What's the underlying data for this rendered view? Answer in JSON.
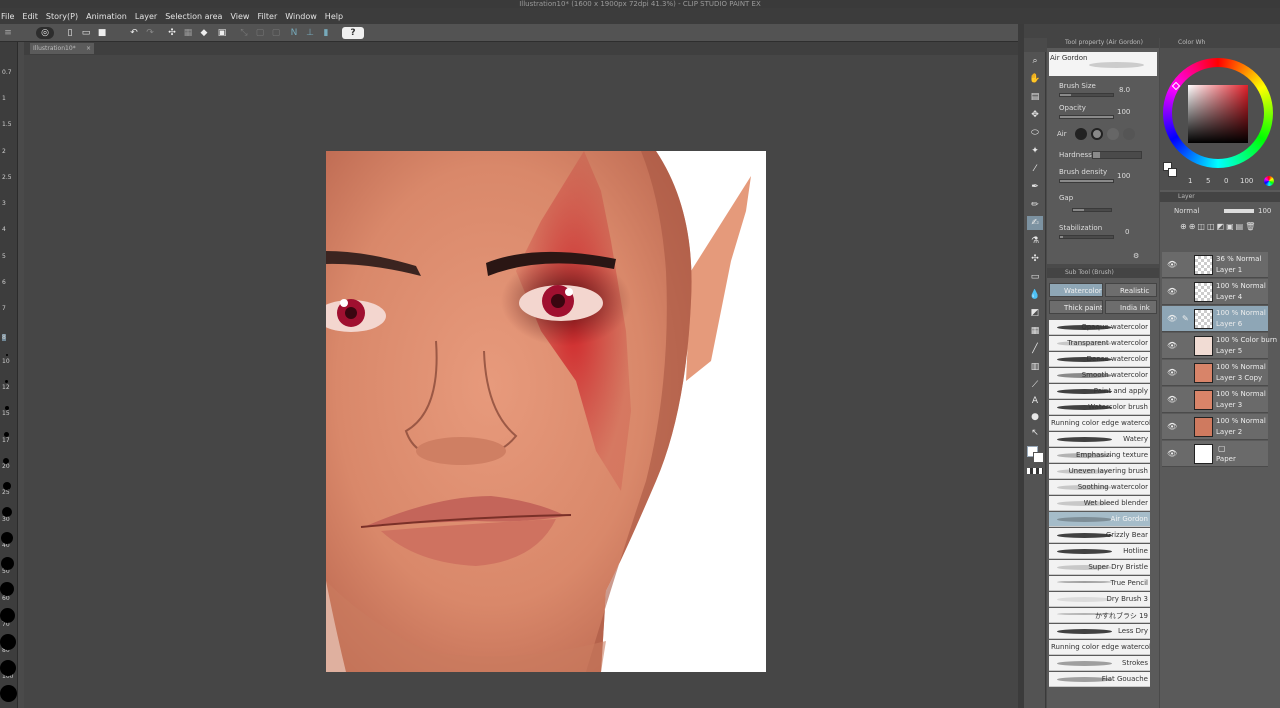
{
  "window": {
    "title": "Illustration10* (1600 x 1900px 72dpi 41.3%) - CLIP STUDIO PAINT EX"
  },
  "menu": [
    "File",
    "Edit",
    "Story(P)",
    "Animation",
    "Layer",
    "Selection area",
    "View",
    "Filter",
    "Window",
    "Help"
  ],
  "doc_tab": "Illustration10*",
  "ruler_labels": [
    "0.7",
    "1",
    "1.5",
    "2",
    "2.5",
    "3",
    "4",
    "5",
    "6",
    "7",
    "8",
    "10",
    "12",
    "15",
    "17",
    "20",
    "25",
    "30",
    "40",
    "50",
    "60",
    "70",
    "80",
    "100"
  ],
  "tool_property": {
    "header": "Tool property (Air Gordon)",
    "brush_name": "Air Gordon",
    "brush_size_label": "Brush Size",
    "brush_size_value": "8.0",
    "opacity_label": "Opacity",
    "opacity_value": "100",
    "air_label": "Air",
    "hardness_label": "Hardness",
    "density_label": "Brush density",
    "density_value": "100",
    "gap_label": "Gap",
    "stabilization_label": "Stabilization",
    "stabilization_value": "0"
  },
  "sub_tool": {
    "header": "Sub Tool (Brush)",
    "tabs": [
      "Watercolor",
      "Realistic",
      "Thick paint",
      "India ink"
    ],
    "brushes": [
      "Opaque watercolor",
      "Transparent watercolor",
      "Dense watercolor",
      "Smooth watercolor",
      "Paint and apply",
      "Watercolor brush",
      "Running color edge watercolor",
      "Watery",
      "Emphasizing texture",
      "Uneven layering brush",
      "Soothing watercolor",
      "Wet bleed blender",
      "Air Gordon",
      "Grizzly Bear",
      "Hotline",
      "Super Dry Bristle",
      "True Pencil",
      "Dry Brush 3",
      "かすれブラシ 19",
      "Less Dry",
      "Running color edge watercolor",
      "Strokes",
      "Flat Gouache"
    ],
    "selected_brush": "Air Gordon"
  },
  "color_panel": {
    "header": "Color Wh",
    "h_value": "1",
    "s_value": "5",
    "v_value": "0",
    "extra_value": "100"
  },
  "layers_panel": {
    "header": "Layer",
    "blend_mode": "Normal",
    "opacity": "100",
    "layers": [
      {
        "line1": "36 % Normal",
        "line2": "Layer 1"
      },
      {
        "line1": "100 % Normal",
        "line2": "Layer 4"
      },
      {
        "line1": "100 % Normal",
        "line2": "Layer 6"
      },
      {
        "line1": "100 % Color burn",
        "line2": "Layer 5"
      },
      {
        "line1": "100 % Normal",
        "line2": "Layer 3 Copy"
      },
      {
        "line1": "100 % Normal",
        "line2": "Layer 3"
      },
      {
        "line1": "100 % Normal",
        "line2": "Layer 2"
      },
      {
        "line1": "",
        "line2": "Paper"
      }
    ],
    "selected_layer": "Layer 6"
  },
  "colors": {
    "skin": "#d9896c",
    "blood": "#c0272d",
    "selected": "#8ea6b6"
  }
}
